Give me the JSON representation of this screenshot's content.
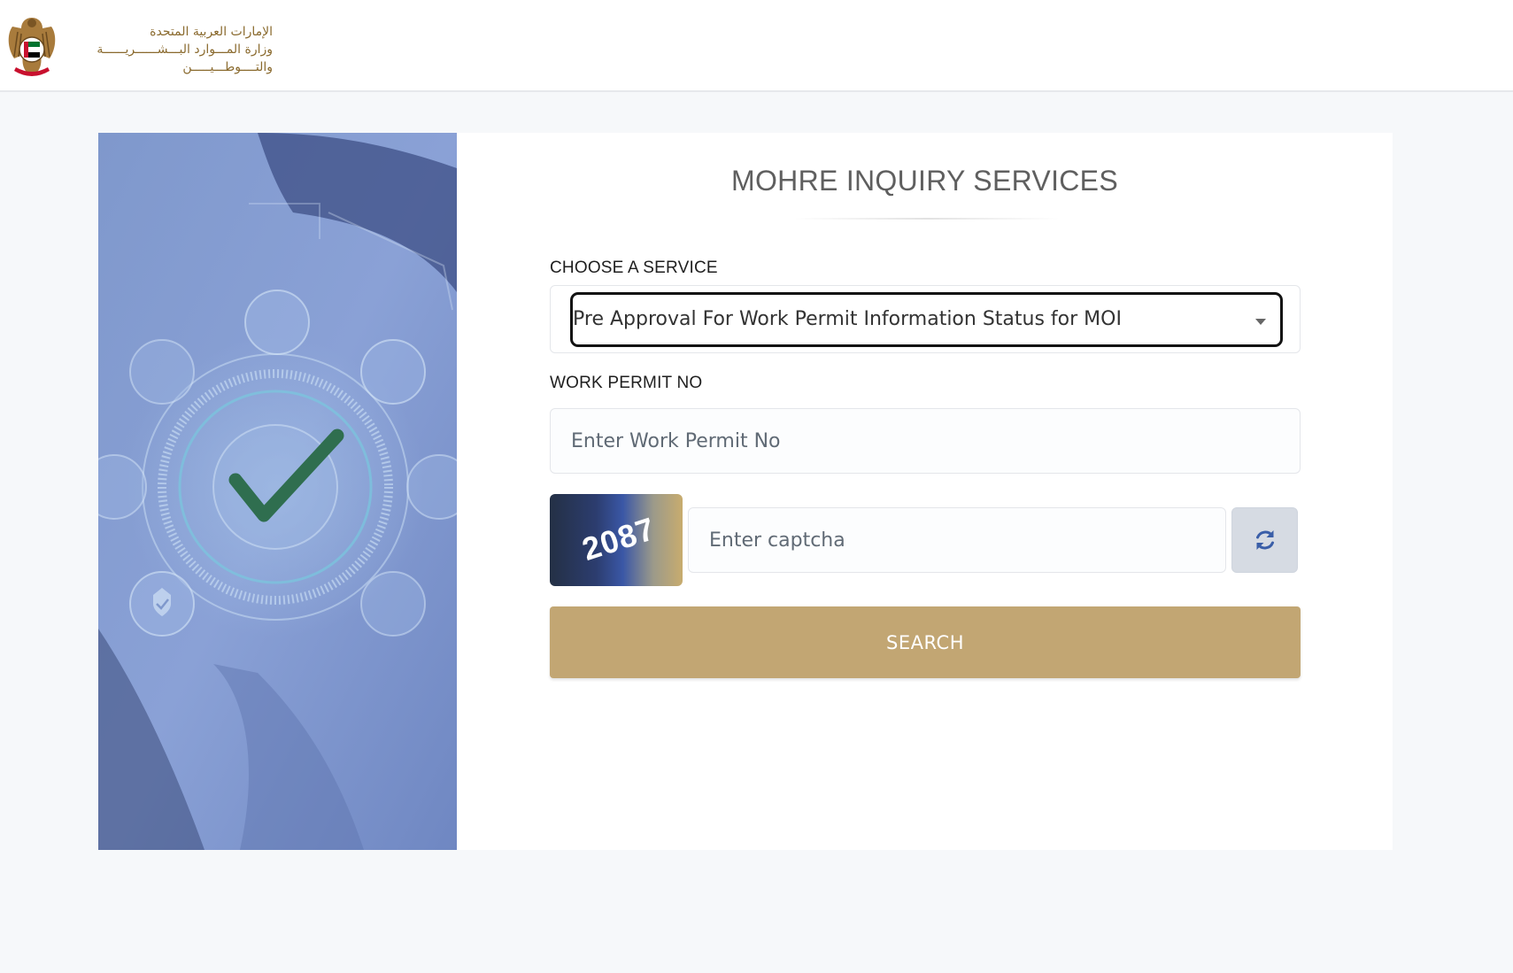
{
  "header": {
    "logo_alt_lines": [
      "الإمارات العربية المتحدة",
      "وزارة المـــوارد البـــشــــــريــــــة",
      "والتــــوطـــيـــــن"
    ]
  },
  "form": {
    "title": "MOHRE INQUIRY SERVICES",
    "service_label": "CHOOSE A SERVICE",
    "service_selected": "Pre Approval For Work Permit Information Status for MOI",
    "permit_label": "WORK PERMIT NO",
    "permit_placeholder": "Enter Work Permit No",
    "captcha_value": "2087",
    "captcha_placeholder": "Enter captcha",
    "search_label": "SEARCH"
  },
  "icons": {
    "refresh": "refresh-icon",
    "check": "checkmark-icon",
    "caret": "chevron-down-icon"
  },
  "colors": {
    "accent": "#c2a673",
    "check": "#2f6e4f",
    "refresh_icon": "#3a5ea8"
  }
}
